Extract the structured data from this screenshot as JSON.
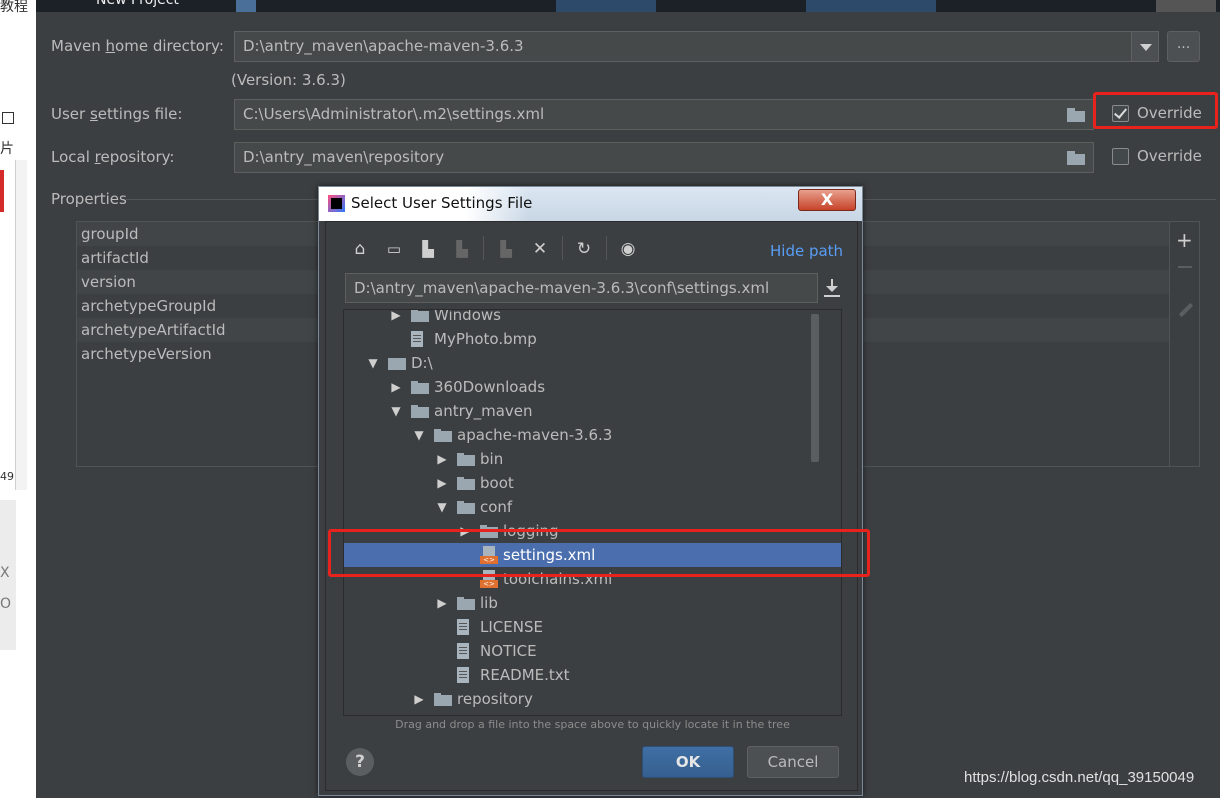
{
  "left_strip": {
    "text_top": "教程",
    "text_mid": "片",
    "text_num": "49",
    "text_x": "X",
    "text_o": "O"
  },
  "window": {
    "title": "New Project"
  },
  "maven": {
    "home_label_pre": "Maven ",
    "home_label_key": "h",
    "home_label_post": "ome directory:",
    "home_value": "D:\\antry_maven\\apache-maven-3.6.3",
    "ellipsis": "...",
    "version_text": "(Version: 3.6.3)",
    "settings_label_pre": "User ",
    "settings_label_key": "s",
    "settings_label_post": "ettings file:",
    "settings_value": "C:\\Users\\Administrator\\.m2\\settings.xml",
    "settings_override_label": "Override",
    "settings_override_checked": true,
    "repo_label_pre": "Local ",
    "repo_label_key": "r",
    "repo_label_post": "epository:",
    "repo_value": "D:\\antry_maven\\repository",
    "repo_override_label": "Override",
    "repo_override_checked": false
  },
  "properties": {
    "title": "Properties",
    "rows": [
      "groupId",
      "artifactId",
      "version",
      "archetypeGroupId",
      "archetypeArtifactId",
      "archetypeVersion"
    ],
    "add_icon": "plus-icon",
    "remove_icon": "minus-icon",
    "edit_icon": "pencil-icon"
  },
  "dialog": {
    "title": "Select User Settings File",
    "close_label": "X",
    "hide_path": "Hide path",
    "path_value": "D:\\antry_maven\\apache-maven-3.6.3\\conf\\settings.xml",
    "tree": [
      {
        "label": "Windows",
        "type": "folder",
        "level": 1,
        "arrow": "▶"
      },
      {
        "label": "MyPhoto.bmp",
        "type": "file",
        "level": 1,
        "arrow": ""
      },
      {
        "label": "D:\\",
        "type": "drive",
        "level": 0,
        "arrow": "▼"
      },
      {
        "label": "360Downloads",
        "type": "folder",
        "level": 1,
        "arrow": "▶"
      },
      {
        "label": "antry_maven",
        "type": "folder",
        "level": 1,
        "arrow": "▼"
      },
      {
        "label": "apache-maven-3.6.3",
        "type": "folder",
        "level": 2,
        "arrow": "▼"
      },
      {
        "label": "bin",
        "type": "folder",
        "level": 3,
        "arrow": "▶"
      },
      {
        "label": "boot",
        "type": "folder",
        "level": 3,
        "arrow": "▶"
      },
      {
        "label": "conf",
        "type": "folder",
        "level": 3,
        "arrow": "▼"
      },
      {
        "label": "logging",
        "type": "folder",
        "level": 4,
        "arrow": "▶"
      },
      {
        "label": "settings.xml",
        "type": "xml",
        "level": 4,
        "arrow": "",
        "selected": true
      },
      {
        "label": "toolchains.xml",
        "type": "xml",
        "level": 4,
        "arrow": ""
      },
      {
        "label": "lib",
        "type": "folder",
        "level": 3,
        "arrow": "▶"
      },
      {
        "label": "LICENSE",
        "type": "file",
        "level": 3,
        "arrow": ""
      },
      {
        "label": "NOTICE",
        "type": "file",
        "level": 3,
        "arrow": ""
      },
      {
        "label": "README.txt",
        "type": "file",
        "level": 3,
        "arrow": ""
      },
      {
        "label": "repository",
        "type": "folder",
        "level": 2,
        "arrow": "▶"
      }
    ],
    "hint": "Drag and drop a file into the space above to quickly locate it in the tree",
    "help_label": "?",
    "ok_label": "OK",
    "cancel_label": "Cancel"
  },
  "annotation_color": "#e8221c",
  "watermark": "https://blog.csdn.net/qq_39150049"
}
